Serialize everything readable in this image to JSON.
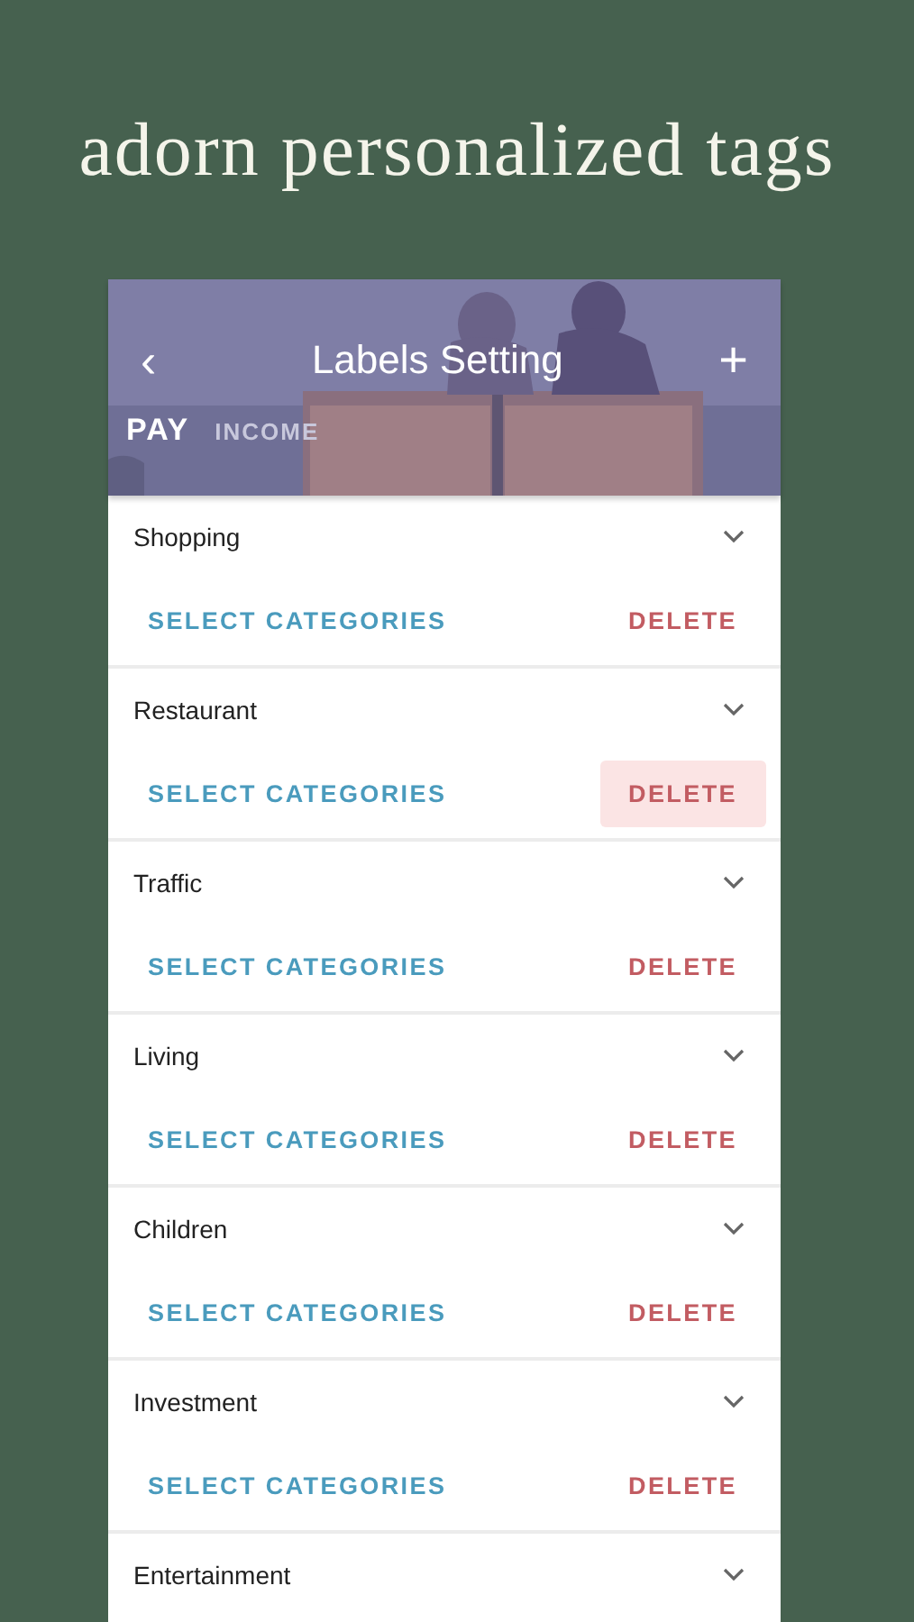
{
  "caption": "adorn personalized tags",
  "header": {
    "back": "‹",
    "title": "Labels Setting",
    "add": "+"
  },
  "tabs": [
    {
      "label": "PAY",
      "selected": true
    },
    {
      "label": "INCOME",
      "selected": false
    }
  ],
  "labels": [
    {
      "name": "Shopping",
      "select": "SELECT CATEGORIES",
      "delete": "DELETE",
      "pressed": false
    },
    {
      "name": "Restaurant",
      "select": "SELECT CATEGORIES",
      "delete": "DELETE",
      "pressed": true
    },
    {
      "name": "Traffic",
      "select": "SELECT CATEGORIES",
      "delete": "DELETE",
      "pressed": false
    },
    {
      "name": "Living",
      "select": "SELECT CATEGORIES",
      "delete": "DELETE",
      "pressed": false
    },
    {
      "name": "Children",
      "select": "SELECT CATEGORIES",
      "delete": "DELETE",
      "pressed": false
    },
    {
      "name": "Investment",
      "select": "SELECT CATEGORIES",
      "delete": "DELETE",
      "pressed": false
    },
    {
      "name": "Entertainment"
    }
  ]
}
